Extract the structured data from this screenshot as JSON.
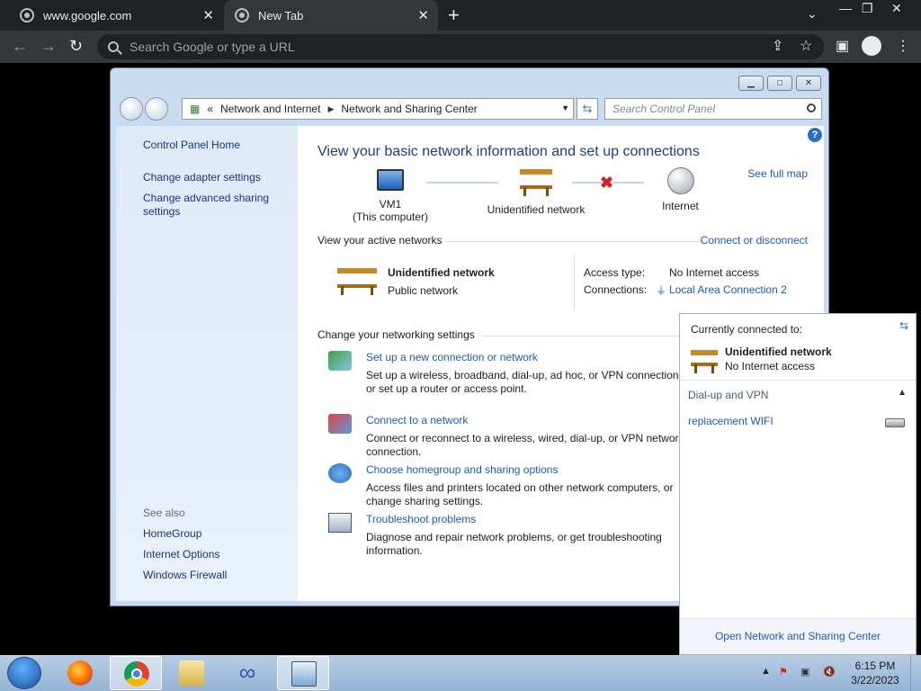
{
  "browser": {
    "tabs": [
      {
        "title": "www.google.com"
      },
      {
        "title": "New Tab"
      }
    ],
    "omnibox_placeholder": "Search Google or type a URL"
  },
  "window": {
    "breadcrumb": [
      "Network and Internet",
      "Network and Sharing Center"
    ],
    "search_placeholder": "Search Control Panel"
  },
  "sidebar": {
    "home": "Control Panel Home",
    "links": [
      "Change adapter settings",
      "Change advanced sharing settings"
    ],
    "see_also_label": "See also",
    "see_also": [
      "HomeGroup",
      "Internet Options",
      "Windows Firewall"
    ]
  },
  "main": {
    "title": "View your basic network information and set up connections",
    "see_full_map": "See full map",
    "map": {
      "computer_name": "VM1",
      "computer_sub": "(This computer)",
      "network": "Unidentified network",
      "internet": "Internet"
    },
    "active_header": "View your active networks",
    "connect_disconnect": "Connect or disconnect",
    "active": {
      "name": "Unidentified network",
      "type": "Public network",
      "access_label": "Access type:",
      "access_value": "No Internet access",
      "conn_label": "Connections:",
      "conn_value": "Local Area Connection 2"
    },
    "settings_header": "Change your networking settings",
    "tasks": [
      {
        "link": "Set up a new connection or network",
        "desc": "Set up a wireless, broadband, dial-up, ad hoc, or VPN connection; or set up a router or access point."
      },
      {
        "link": "Connect to a network",
        "desc": "Connect or reconnect to a wireless, wired, dial-up, or VPN network connection."
      },
      {
        "link": "Choose homegroup and sharing options",
        "desc": "Access files and printers located on other network computers, or change sharing settings."
      },
      {
        "link": "Troubleshoot problems",
        "desc": "Diagnose and repair network problems, or get troubleshooting information."
      }
    ]
  },
  "flyout": {
    "currently": "Currently connected to:",
    "network": "Unidentified network",
    "status": "No Internet access",
    "section": "Dial-up and VPN",
    "vpn_item": "replacement WIFI",
    "open_center": "Open Network and Sharing Center"
  },
  "taskbar": {
    "time": "6:15 PM",
    "date": "3/22/2023"
  },
  "colors": {
    "link": "#1e5cb3",
    "title": "#1e3c87",
    "chrome_bg": "#202124"
  }
}
